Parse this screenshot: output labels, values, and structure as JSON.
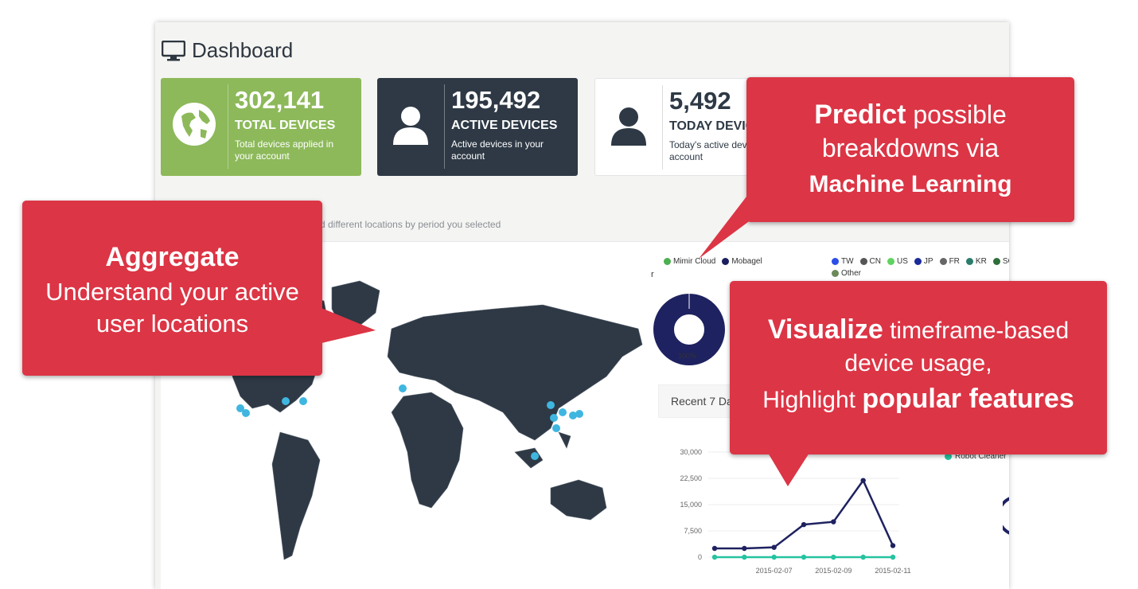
{
  "dashboard": {
    "title": "Dashboard",
    "icon": "monitor-icon"
  },
  "cards": [
    {
      "value": "302,141",
      "label": "TOTAL DEVICES",
      "sub": "Total devices applied in your account",
      "icon": "globe-icon",
      "color": "#8db95a"
    },
    {
      "value": "195,492",
      "label": "ACTIVE DEVICES",
      "sub": "Active devices in your account",
      "icon": "user-icon",
      "color": "#2e3945"
    },
    {
      "value": "5,492",
      "label": "TODAY DEVIC",
      "sub": "Today's active dev your account",
      "icon": "user-icon",
      "color": "#ffffff"
    }
  ],
  "map_panel": {
    "subtitle": "d different locations by period you selected"
  },
  "legend_top_left": [
    {
      "label": "Mimir Cloud",
      "color": "#4caf50"
    },
    {
      "label": "Mobagel",
      "color": "#1a1f5e"
    }
  ],
  "legend_top_right": [
    {
      "label": "TW",
      "color": "#2b4de8"
    },
    {
      "label": "CN",
      "color": "#555555"
    },
    {
      "label": "US",
      "color": "#5fd35f"
    },
    {
      "label": "JP",
      "color": "#1a2a9a"
    },
    {
      "label": "FR",
      "color": "#666666"
    },
    {
      "label": "KR",
      "color": "#2a7d6a"
    },
    {
      "label": "SG",
      "color": "#2e6e3a"
    },
    {
      "label": "Other",
      "color": "#6b8a5a"
    }
  ],
  "stray_label": "r",
  "donut_label": "100%",
  "recent": {
    "label": "Recent 7 Da"
  },
  "line_legend": {
    "label": "Robot Cleaner",
    "color": "#26c3a0"
  },
  "chart_data": {
    "type": "line",
    "x": [
      "2015-02-05",
      "2015-02-06",
      "2015-02-07",
      "2015-02-08",
      "2015-02-09",
      "2015-02-10",
      "2015-02-11"
    ],
    "xticks": [
      "2015-02-07",
      "2015-02-09",
      "2015-02-11"
    ],
    "yticks": [
      "0",
      "7,500",
      "15,000",
      "22,500",
      "30,000"
    ],
    "ylim": [
      0,
      30000
    ],
    "series": [
      {
        "values": [
          2500,
          2500,
          2800,
          9300,
          10100,
          21900,
          3300
        ],
        "color": "#1e2260"
      },
      {
        "name": "Robot Cleaner",
        "values": [
          0,
          0,
          0,
          0,
          0,
          0,
          0
        ],
        "color": "#26c3a0"
      }
    ],
    "x_positions": [
      0,
      1,
      2,
      3,
      4,
      5,
      6
    ],
    "grid": true
  },
  "callouts": {
    "aggregate": {
      "title": "Aggregate",
      "body": "Understand your active user locations"
    },
    "predict": {
      "bold1": "Predict",
      "rest1": " possible",
      "line2": "breakdowns via",
      "bold3": "Machine Learning"
    },
    "visualize": {
      "bold1": "Visualize",
      "rest1": " timeframe-based",
      "line2": "device usage,",
      "rest3": "Highlight ",
      "bold3": "popular features"
    }
  },
  "map_markers_color": "#3fb6e0"
}
